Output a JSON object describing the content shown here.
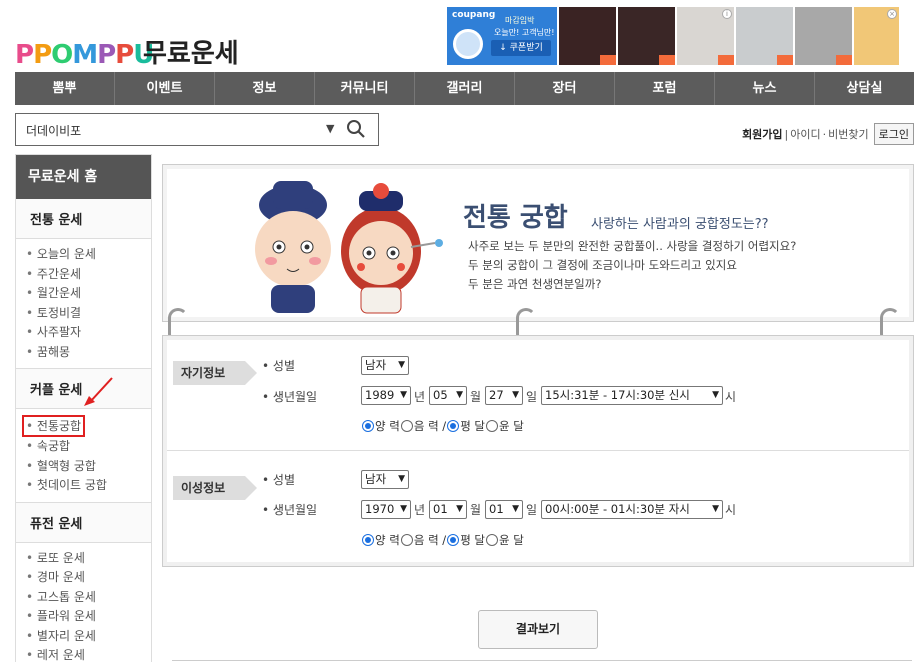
{
  "header": {
    "logo_letters": [
      "P",
      "P",
      "O",
      "M",
      "P",
      "P",
      "U"
    ],
    "site_title": "무료운세"
  },
  "ad": {
    "brand": "coupang",
    "line1": "마감임박",
    "line2": "오늘만! 고객님만!",
    "button": "쿠폰받기"
  },
  "nav": {
    "items": [
      "뽐뿌",
      "이벤트",
      "정보",
      "커뮤니티",
      "갤러리",
      "장터",
      "포럼",
      "뉴스",
      "상담실"
    ]
  },
  "search": {
    "value": "더데이비포"
  },
  "account": {
    "join": "회원가입",
    "sep1": "|",
    "id": "아이디",
    "dot": "·",
    "pw": "비번찾기",
    "login": "로그인"
  },
  "sidebar": {
    "home": "무료운세 홈",
    "sections": [
      {
        "title": "전통 운세",
        "items": [
          "오늘의 운세",
          "주간운세",
          "월간운세",
          "토정비결",
          "사주팔자",
          "꿈해몽"
        ]
      },
      {
        "title": "커플 운세",
        "items": [
          "전통궁합",
          "속궁합",
          "혈액형 궁합",
          "첫데이트 궁합"
        ]
      },
      {
        "title": "퓨전 운세",
        "items": [
          "로또 운세",
          "경마 운세",
          "고스톱 운세",
          "플라워 운세",
          "별자리 운세",
          "레저 운세"
        ]
      }
    ]
  },
  "banner": {
    "title": "전통 궁합",
    "subtitle": "사랑하는 사람과의 궁합정도는??",
    "desc": [
      "사주로 보는 두 분만의 완전한 궁합풀이.. 사랑을 결정하기 어렵지요?",
      "두 분의 궁합이 그 결정에 조금이나마 도와드리고 있지요",
      "두 분은 과연 천생연분일까?"
    ]
  },
  "form": {
    "self": {
      "tag": "자기정보",
      "gender_label": "성별",
      "gender": "남자",
      "birth_label": "생년월일",
      "year": "1989",
      "month": "05",
      "day": "27",
      "time": "15시:31분 - 17시:30분 신시",
      "unit_year": "년",
      "unit_month": "월",
      "unit_day": "일",
      "unit_hour": "시",
      "r1": "양 력",
      "r2": "음 력 /",
      "r3": "평 달",
      "r4": "윤 달"
    },
    "other": {
      "tag": "이성정보",
      "gender_label": "성별",
      "gender": "남자",
      "birth_label": "생년월일",
      "year": "1970",
      "month": "01",
      "day": "01",
      "time": "00시:00분 - 01시:30분 자시",
      "unit_year": "년",
      "unit_month": "월",
      "unit_day": "일",
      "unit_hour": "시",
      "r1": "양 력",
      "r2": "음 력 /",
      "r3": "평 달",
      "r4": "윤 달"
    },
    "submit": "결과보기"
  },
  "colors": {
    "nav_bg": "#5c5c5c",
    "sidebar_home_bg": "#555555",
    "banner_title": "#3b4f72",
    "highlight": "#e02020",
    "radio": "#1a6fe0"
  }
}
